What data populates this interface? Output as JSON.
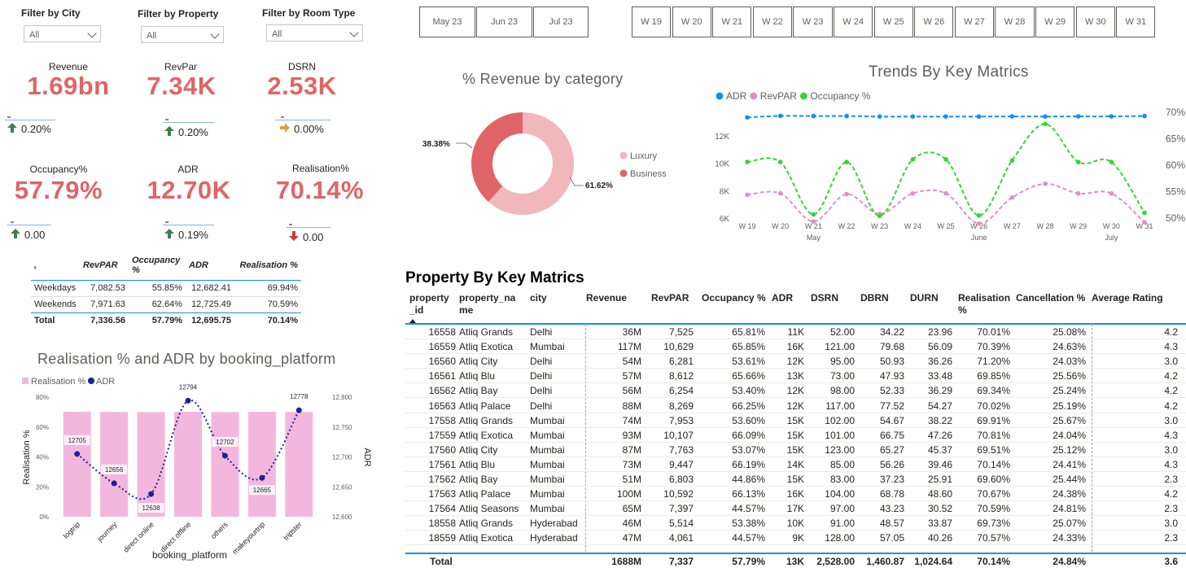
{
  "filters": [
    {
      "title": "Filter by City",
      "value": "All"
    },
    {
      "title": "Filter by Property",
      "value": "All"
    },
    {
      "title": "Filter by Room Type",
      "value": "All"
    }
  ],
  "months": [
    "May 23",
    "Jun 23",
    "Jul 23"
  ],
  "weeks": [
    "W 19",
    "W 20",
    "W 21",
    "W 22",
    "W 23",
    "W 24",
    "W 25",
    "W 26",
    "W 27",
    "W 28",
    "W 29",
    "W 30",
    "W 31"
  ],
  "kpis": [
    {
      "label": "Revenue",
      "value": "1.69bn",
      "change": "0.20%",
      "dir": "up"
    },
    {
      "label": "RevPar",
      "value": "7.34K",
      "change": "0.20%",
      "dir": "up"
    },
    {
      "label": "DSRN",
      "value": "2.53K",
      "change": "0.00%",
      "dir": "flat"
    },
    {
      "label": "Occupancy%",
      "value": "57.79%",
      "change": "0.00",
      "dir": "up"
    },
    {
      "label": "ADR",
      "value": "12.70K",
      "change": "0.19%",
      "dir": "up"
    },
    {
      "label": "Realisation%",
      "value": "70.14%",
      "change": "0.00",
      "dir": "down"
    }
  ],
  "day_table": {
    "headers": [
      ",",
      "RevPAR",
      "Occupancy %",
      "ADR",
      "Realisation %"
    ],
    "rows": [
      [
        "Weekdays",
        "7,082.53",
        "55.85%",
        "12,682.41",
        "69.94%"
      ],
      [
        "Weekends",
        "7,971.63",
        "62.64%",
        "12,725.49",
        "70.59%"
      ]
    ],
    "total": [
      "Total",
      "7,336.56",
      "57.79%",
      "12,695.75",
      "70.14%"
    ]
  },
  "colors": {
    "kpi_value": "#e06467",
    "arrow_up": "#3e7f52",
    "arrow_flat": "#d9a23a",
    "arrow_down": "#d33a2c",
    "luxury": "#f0b8ba",
    "business": "#e06467",
    "adr_line": "#118dff",
    "revpar_line": "#e88cc9",
    "occupancy_line": "#35d535",
    "bar_pink": "#f3b7dd",
    "adr_dots": "#12239e"
  },
  "donut": {
    "title": "% Revenue by category",
    "legend": [
      "Luxury",
      "Business"
    ],
    "chart_data": {
      "type": "pie",
      "categories": [
        "Luxury",
        "Business"
      ],
      "values": [
        61.62,
        38.38
      ],
      "labels": [
        "61.62%",
        "38.38%"
      ],
      "legend_position": "right"
    }
  },
  "trend": {
    "title": "Trends By Key Matrics",
    "legend": [
      "ADR",
      "RevPAR",
      "Occupancy %"
    ],
    "y_left_ticks": [
      "12K",
      "10K",
      "8K",
      "6K"
    ],
    "y_right_ticks": [
      "70%",
      "65%",
      "60%",
      "55%",
      "50%"
    ],
    "month_labels": [
      "May",
      "June",
      "July"
    ],
    "chart_data": {
      "type": "line",
      "x": [
        "W 19",
        "W 20",
        "W 21",
        "W 22",
        "W 23",
        "W 24",
        "W 25",
        "W 26",
        "W 27",
        "W 28",
        "W 29",
        "W 30",
        "W 31"
      ],
      "series": [
        {
          "name": "ADR",
          "axis": "left",
          "values": [
            12650,
            12770,
            12760,
            12760,
            12720,
            12720,
            12720,
            12720,
            12730,
            12720,
            12730,
            12730,
            12760
          ]
        },
        {
          "name": "RevPAR",
          "axis": "left",
          "values": [
            7700,
            7800,
            5750,
            7750,
            6300,
            7800,
            7800,
            5600,
            7500,
            8500,
            7800,
            7800,
            5700
          ]
        },
        {
          "name": "Occupancy %",
          "axis": "right",
          "values": [
            60.6,
            60.6,
            50.7,
            60.6,
            50.4,
            61.1,
            61.1,
            50.5,
            60.9,
            67.8,
            60.6,
            60.6,
            51.0
          ]
        }
      ],
      "ylim_left": [
        6000,
        13000
      ],
      "ylim_right": [
        50,
        70
      ],
      "legend_position": "top-left"
    }
  },
  "platform": {
    "title": "Realisation % and ADR by booking_platform",
    "legend": [
      "Realisation %",
      "ADR"
    ],
    "xlabel": "booking_platform",
    "ylabel_left": "Realisation %",
    "ylabel_right": "ADR",
    "y_left_ticks": [
      "80%",
      "60%",
      "40%",
      "20%",
      "0%"
    ],
    "y_right_ticks": [
      "12,800",
      "12,750",
      "12,700",
      "12,650",
      "12,600"
    ],
    "chart_data": {
      "type": "bar",
      "categories": [
        "logtrip",
        "journey",
        "direct online",
        "direct offline",
        "others",
        "makeyourtrip",
        "tripster"
      ],
      "series": [
        {
          "name": "Realisation %",
          "axis": "left",
          "values": [
            70.2,
            70.1,
            70.0,
            70.2,
            70.0,
            70.2,
            70.1
          ]
        },
        {
          "name": "ADR",
          "axis": "right",
          "values": [
            12705,
            12656,
            12638,
            12794,
            12702,
            12665,
            12778
          ]
        }
      ],
      "data_labels": [
        "12705",
        "12656",
        "12638",
        "12794",
        "12702",
        "12665",
        "12778"
      ],
      "ylim_left": [
        0,
        80
      ],
      "ylim_right": [
        12600,
        12800
      ]
    }
  },
  "property_table": {
    "title": "Property By Key Matrics",
    "headers": [
      "property\n_id",
      "property_na\nme",
      "city",
      "Revenue",
      "RevPAR",
      "Occupancy %",
      "ADR",
      "DSRN",
      "DBRN",
      "DURN",
      "Realisation\n%",
      "Cancellation %",
      "Average Rating"
    ],
    "rows": [
      [
        "16558",
        "Atliq Grands",
        "Delhi",
        "36M",
        "7,525",
        "65.81%",
        "11K",
        "52.00",
        "34.22",
        "23.96",
        "70.01%",
        "25.08%",
        "4.2"
      ],
      [
        "16559",
        "Atliq Exotica",
        "Mumbai",
        "117M",
        "10,629",
        "65.85%",
        "16K",
        "121.00",
        "79.68",
        "56.09",
        "70.39%",
        "24.63%",
        "4.3"
      ],
      [
        "16560",
        "Atliq City",
        "Delhi",
        "54M",
        "6,281",
        "53.61%",
        "12K",
        "95.00",
        "50.93",
        "36.26",
        "71.20%",
        "24.03%",
        "3.0"
      ],
      [
        "16561",
        "Atliq Blu",
        "Delhi",
        "57M",
        "8,612",
        "65.66%",
        "13K",
        "73.00",
        "47.93",
        "33.48",
        "69.85%",
        "25.56%",
        "4.2"
      ],
      [
        "16562",
        "Atliq Bay",
        "Delhi",
        "56M",
        "6,254",
        "53.40%",
        "12K",
        "98.00",
        "52.33",
        "36.29",
        "69.34%",
        "25.24%",
        "4.2"
      ],
      [
        "16563",
        "Atliq Palace",
        "Delhi",
        "88M",
        "8,269",
        "66.25%",
        "12K",
        "117.00",
        "77.52",
        "54.27",
        "70.02%",
        "25.19%",
        "4.2"
      ],
      [
        "17558",
        "Atliq Grands",
        "Mumbai",
        "74M",
        "7,953",
        "53.60%",
        "15K",
        "102.00",
        "54.67",
        "38.22",
        "69.91%",
        "25.67%",
        "3.0"
      ],
      [
        "17559",
        "Atliq Exotica",
        "Mumbai",
        "93M",
        "10,107",
        "66.09%",
        "15K",
        "101.00",
        "66.75",
        "47.26",
        "70.81%",
        "24.04%",
        "4.3"
      ],
      [
        "17560",
        "Atliq City",
        "Mumbai",
        "87M",
        "7,763",
        "53.07%",
        "15K",
        "123.00",
        "65.27",
        "45.37",
        "69.51%",
        "25.12%",
        "3.0"
      ],
      [
        "17561",
        "Atliq Blu",
        "Mumbai",
        "73M",
        "9,447",
        "66.19%",
        "14K",
        "85.00",
        "56.26",
        "39.46",
        "70.14%",
        "24.41%",
        "4.3"
      ],
      [
        "17562",
        "Atliq Bay",
        "Mumbai",
        "51M",
        "6,803",
        "44.86%",
        "15K",
        "83.00",
        "37.23",
        "25.91",
        "69.60%",
        "25.44%",
        "2.3"
      ],
      [
        "17563",
        "Atliq Palace",
        "Mumbai",
        "100M",
        "10,592",
        "66.13%",
        "16K",
        "104.00",
        "68.78",
        "48.60",
        "70.67%",
        "24.38%",
        "4.2"
      ],
      [
        "17564",
        "Atliq Seasons",
        "Mumbai",
        "65M",
        "7,397",
        "44.57%",
        "17K",
        "97.00",
        "43.23",
        "30.52",
        "70.59%",
        "24.81%",
        "2.3"
      ],
      [
        "18558",
        "Atliq Grands",
        "Hyderabad",
        "46M",
        "5,514",
        "53.38%",
        "10K",
        "91.00",
        "48.57",
        "33.87",
        "69.73%",
        "25.07%",
        "3.0"
      ],
      [
        "18559",
        "Atliq Exotica",
        "Hyderabad",
        "47M",
        "4,061",
        "44.57%",
        "9K",
        "128.00",
        "57.05",
        "40.26",
        "70.57%",
        "24.33%",
        "2.3"
      ]
    ],
    "total": [
      "Total",
      "",
      "",
      "1688M",
      "7,337",
      "57.79%",
      "13K",
      "2,528.00",
      "1,460.87",
      "1,024.64",
      "70.14%",
      "24.84%",
      "3.6"
    ]
  }
}
